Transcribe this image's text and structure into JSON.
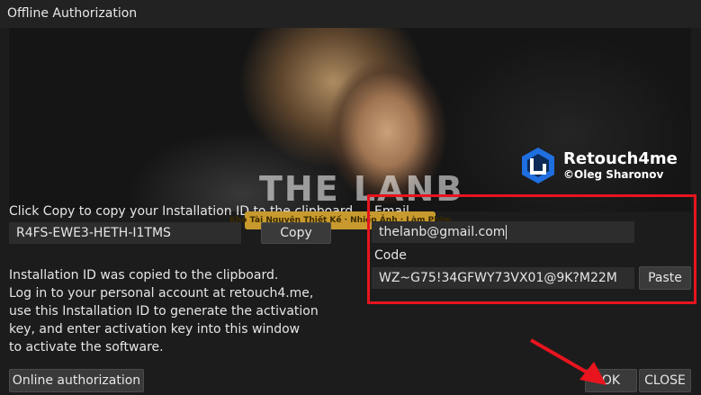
{
  "window": {
    "title": "Offline Authorization"
  },
  "brand": {
    "name": "Retouch4me",
    "author": "©Oleg Sharonov"
  },
  "watermark": {
    "big": "THE LANB",
    "band": "Kho Tài Nguyên Thiết Kế · Nhiếp Ảnh · Làm Phim"
  },
  "install": {
    "instruction": "Click Copy to copy your Installation ID to the clipboard.",
    "id_value": "R4FS-EWE3-HETH-I1TMS",
    "copy_label": "Copy",
    "info_lines": [
      "Installation ID was copied to the clipboard.",
      "Log in to your personal account at retouch4.me,",
      "use this Installation ID to generate the activation",
      "key, and enter activation key into this window",
      "to activate the software."
    ]
  },
  "auth": {
    "email_label": "Email",
    "email_value": "thelanb@gmail.com",
    "code_label": "Code",
    "code_value": "WZ~G75!34GFWY73VX01@9K?M22M",
    "paste_label": "Paste"
  },
  "footer": {
    "online_label": "Online authorization",
    "ok_label": "OK",
    "close_label": "CLOSE"
  },
  "colors": {
    "highlight": "#e8141e",
    "logo_blue": "#1f6fe0"
  }
}
